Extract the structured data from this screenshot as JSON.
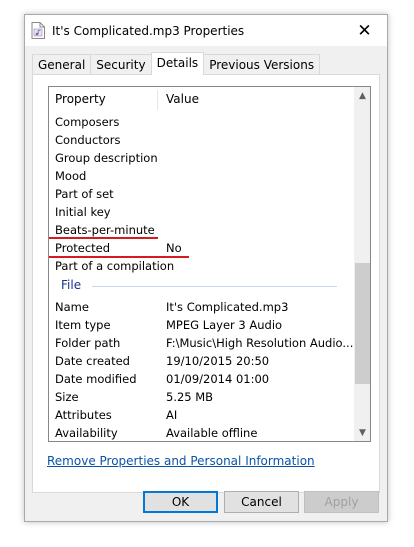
{
  "window": {
    "title": "It's Complicated.mp3 Properties",
    "close_glyph": "✕"
  },
  "tabs": [
    {
      "label": "General"
    },
    {
      "label": "Security"
    },
    {
      "label": "Details",
      "active": true
    },
    {
      "label": "Previous Versions"
    }
  ],
  "details": {
    "columns": {
      "property": "Property",
      "value": "Value"
    },
    "rows": [
      {
        "property": "Composers",
        "value": ""
      },
      {
        "property": "Conductors",
        "value": ""
      },
      {
        "property": "Group description",
        "value": ""
      },
      {
        "property": "Mood",
        "value": ""
      },
      {
        "property": "Part of set",
        "value": ""
      },
      {
        "property": "Initial key",
        "value": ""
      },
      {
        "property": "Beats-per-minute",
        "value": ""
      },
      {
        "property": "Protected",
        "value": "No"
      },
      {
        "property": "Part of a compilation",
        "value": ""
      }
    ],
    "file_group_label": "File",
    "file_rows": [
      {
        "property": "Name",
        "value": "It's Complicated.mp3"
      },
      {
        "property": "Item type",
        "value": "MPEG Layer 3 Audio"
      },
      {
        "property": "Folder path",
        "value": "F:\\Music\\High Resolution Audio..."
      },
      {
        "property": "Date created",
        "value": "19/10/2015 20:50"
      },
      {
        "property": "Date modified",
        "value": "01/09/2014 01:00"
      },
      {
        "property": "Size",
        "value": "5.25 MB"
      },
      {
        "property": "Attributes",
        "value": "AI"
      },
      {
        "property": "Availability",
        "value": "Available offline"
      }
    ],
    "highlight_color": "#d71920"
  },
  "remove_link": "Remove Properties and Personal Information",
  "buttons": {
    "ok": "OK",
    "cancel": "Cancel",
    "apply": "Apply"
  },
  "icons": {
    "title": "mp3-file-icon",
    "scroll_up": "chevron-up-icon",
    "scroll_down": "chevron-down-icon"
  }
}
